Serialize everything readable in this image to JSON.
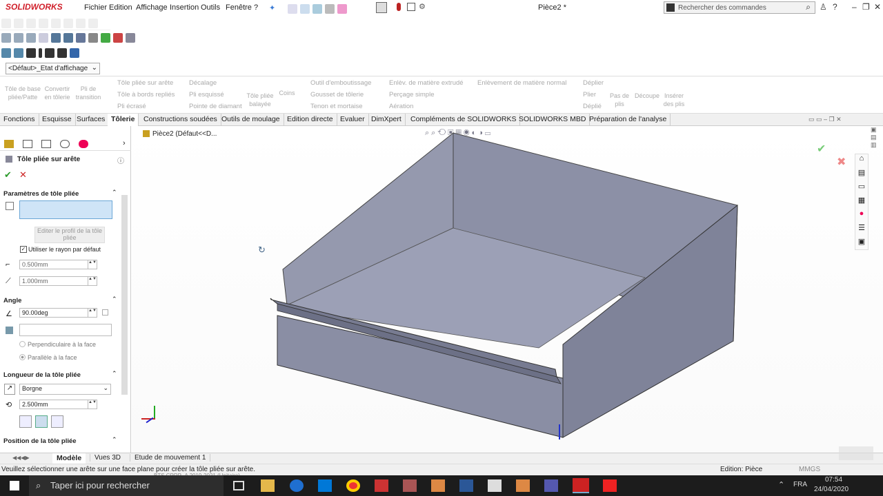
{
  "app": {
    "logo": "SOLIDWORKS",
    "doc_title": "Pièce2 *",
    "search_placeholder": "Rechercher des commandes"
  },
  "menu": [
    "Fichier",
    "Edition",
    "Affichage",
    "Insertion",
    "Outils",
    "Fenêtre",
    "?"
  ],
  "display_state": "<Défaut>_Etat d'affichage",
  "ribbon": {
    "big": [
      "Tôle de base pliée/Patte",
      "Convertir en tôlerie",
      "Pli de transition",
      "Coins",
      "Tôle pliée balayée",
      "Pas de plis",
      "Découpe",
      "Insérer des plis"
    ],
    "small_col1": [
      "Tôle pliée sur arête",
      "Tôle à bords repliés",
      "Pli écrasé"
    ],
    "small_col2": [
      "Décalage",
      "Pli esquissé",
      "Pointe de diamant"
    ],
    "small_col3": [
      "Outil d'emboutissage",
      "Gousset de tôlerie",
      "Tenon et mortaise"
    ],
    "small_col4": [
      "Enlèv. de matière extrudé",
      "Perçage simple",
      "Aération"
    ],
    "small_col5": [
      "Enlèvement de matière normal"
    ],
    "small_col6": [
      "Déplier",
      "Plier",
      "Déplié"
    ]
  },
  "tabs": [
    "Fonctions",
    "Esquisse",
    "Surfaces",
    "Tôlerie",
    "Constructions soudées",
    "Outils de moulage",
    "Edition directe",
    "Evaluer",
    "DimXpert",
    "Compléments de SOLIDWORKS",
    "SOLIDWORKS MBD",
    "Préparation de l'analyse"
  ],
  "active_tab": "Tôlerie",
  "panel": {
    "title": "Tôle pliée sur arête",
    "sec_params": "Paramètres de tôle pliée",
    "edit_profile": "Editer le profil de la tôle pliée",
    "use_default_radius": "Utiliser le rayon par défaut",
    "radius": "0.500mm",
    "thickness": "1.000mm",
    "sec_angle": "Angle",
    "angle": "90.00deg",
    "perp": "Perpendiculaire à la face",
    "parallel": "Parallèle à la face",
    "sec_length": "Longueur de la tôle pliée",
    "end_condition": "Borgne",
    "length": "2.500mm",
    "sec_position": "Position de la tôle pliée"
  },
  "tree_label": "Pièce2  (Défaut<<D...",
  "bottom_tabs": [
    "Modèle",
    "Vues 3D",
    "Etude de mouvement 1"
  ],
  "status": {
    "message": "Veuillez sélectionner une arête sur une face plane pour créer la tôle pliée sur arête.",
    "edit": "Edition: Pièce",
    "units": "MMGS",
    "license": "BTS CPRP_A 2019-2021 (Unitaire)"
  },
  "taskbar": {
    "search": "Taper ici pour rechercher",
    "lang": "FRA",
    "time": "07:54",
    "date": "24/04/2020"
  },
  "colors": {
    "accent": "#d01f2a",
    "part_fill": "#8f93a8",
    "part_dark": "#6e7288"
  }
}
